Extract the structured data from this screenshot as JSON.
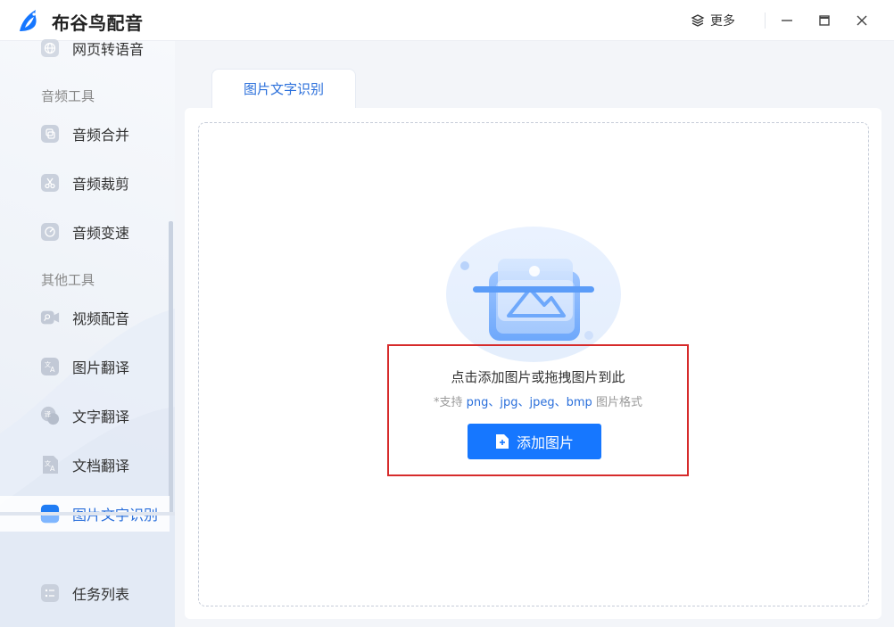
{
  "app": {
    "title": "布谷鸟配音"
  },
  "titlebar": {
    "more_label": "更多",
    "minimize_glyph": "—",
    "maximize_glyph": "▭",
    "close_glyph": "✕"
  },
  "sidebar": {
    "top_item": {
      "label": "网页转语音",
      "icon": "globe-icon"
    },
    "sections": [
      {
        "title": "音频工具",
        "items": [
          {
            "label": "音频合并",
            "icon": "merge-icon"
          },
          {
            "label": "音频裁剪",
            "icon": "scissors-icon"
          },
          {
            "label": "音频变速",
            "icon": "speed-icon"
          }
        ]
      },
      {
        "title": "其他工具",
        "items": [
          {
            "label": "视频配音",
            "icon": "video-mic-icon"
          },
          {
            "label": "图片翻译",
            "icon": "image-translate-icon"
          },
          {
            "label": "文字翻译",
            "icon": "text-translate-icon"
          },
          {
            "label": "文档翻译",
            "icon": "doc-translate-icon"
          },
          {
            "label": "图片文字识别",
            "icon": "ocr-icon",
            "active": true
          }
        ]
      }
    ],
    "bottom_item": {
      "label": "任务列表",
      "icon": "task-list-icon"
    }
  },
  "tabs": [
    {
      "label": "图片文字识别",
      "active": true
    }
  ],
  "dropzone": {
    "hint_main": "点击添加图片或拖拽图片到此",
    "hint_sub_prefix": "*支持 ",
    "hint_sub_formats": "png、jpg、jpeg、bmp",
    "hint_sub_suffix": " 图片格式",
    "button_label": "添加图片"
  },
  "colors": {
    "accent": "#1677ff",
    "active_text": "#2a6fdb",
    "highlight_border": "#d62b2b"
  }
}
